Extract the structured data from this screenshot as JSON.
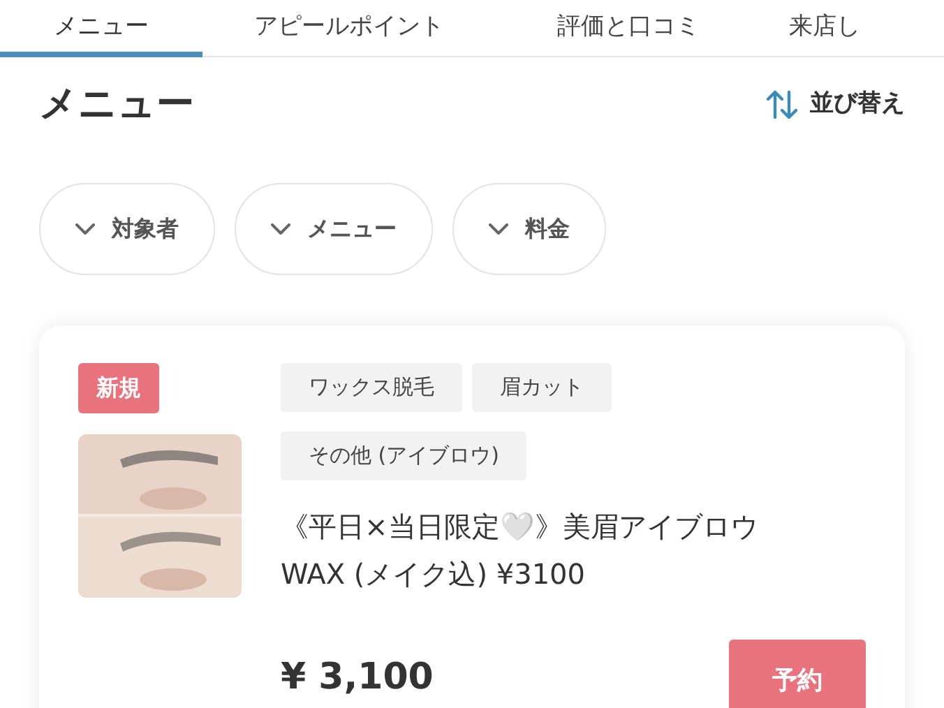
{
  "tabs": [
    {
      "label": "メニュー",
      "selected": true
    },
    {
      "label": "アピールポイント",
      "selected": false
    },
    {
      "label": "評価と口コミ",
      "selected": false
    },
    {
      "label": "来店し",
      "selected": false
    }
  ],
  "heading": "メニュー",
  "sort_button": {
    "label": "並び替え"
  },
  "filters": [
    {
      "label": "対象者"
    },
    {
      "label": "メニュー"
    },
    {
      "label": "料金"
    }
  ],
  "menu_item": {
    "badge": "新規",
    "image": {
      "kind": "picture"
    },
    "tags": [
      "ワックス脱毛",
      "眉カット",
      "その他 (アイブロウ)"
    ],
    "title": "《平日×当日限定🤍》美眉アイブロウ WAX (メイク込) ¥3100",
    "price": "¥ 3,100",
    "reserve_button": "予約"
  }
}
